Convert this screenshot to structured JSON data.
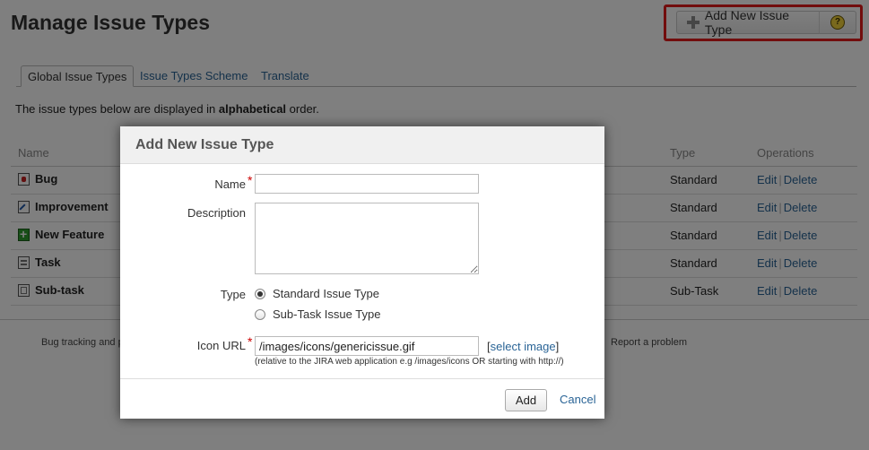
{
  "page": {
    "title": "Manage Issue Types",
    "add_button_label": "Add New Issue Type",
    "help_icon": "question-mark-icon",
    "tabs": [
      {
        "label": "Global Issue Types",
        "active": true
      },
      {
        "label": "Issue Types Scheme",
        "active": false
      },
      {
        "label": "Translate",
        "active": false
      }
    ],
    "intro_prefix": "The issue types below are displayed in ",
    "intro_bold": "alphabetical",
    "intro_suffix": " order.",
    "table": {
      "headers": {
        "name": "Name",
        "type": "Type",
        "operations": "Operations"
      },
      "rows": [
        {
          "name": "Bug",
          "icon": "bug-icon",
          "type": "Standard",
          "edit": "Edit",
          "delete": "Delete"
        },
        {
          "name": "Improvement",
          "icon": "improvement-icon",
          "type": "Standard",
          "edit": "Edit",
          "delete": "Delete"
        },
        {
          "name": "New Feature",
          "icon": "new-feature-icon",
          "type": "Standard",
          "edit": "Edit",
          "delete": "Delete"
        },
        {
          "name": "Task",
          "icon": "task-icon",
          "type": "Standard",
          "edit": "Edit",
          "delete": "Delete"
        },
        {
          "name": "Sub-task",
          "icon": "subtask-icon",
          "type": "Sub-Task",
          "edit": "Edit",
          "delete": "Delete"
        }
      ]
    },
    "footer_left": "Bug tracking and p",
    "footer_right": "Report a problem"
  },
  "dialog": {
    "title": "Add New Issue Type",
    "name_label": "Name",
    "name_value": "",
    "description_label": "Description",
    "description_value": "",
    "type_label": "Type",
    "type_options": [
      "Standard Issue Type",
      "Sub-Task Issue Type"
    ],
    "type_selected": "Standard Issue Type",
    "icon_url_label": "Icon URL",
    "icon_url_value": "/images/icons/genericissue.gif",
    "select_image_open": "[",
    "select_image_label": "select image",
    "select_image_close": "]",
    "icon_url_hint": "(relative to the JIRA web application e.g /images/icons OR starting with http://)",
    "add_button": "Add",
    "cancel_link": "Cancel"
  },
  "colors": {
    "accent_red": "#e41b1b",
    "link_blue": "#2a6496",
    "overlay": "rgba(0,0,0,0.5)"
  }
}
